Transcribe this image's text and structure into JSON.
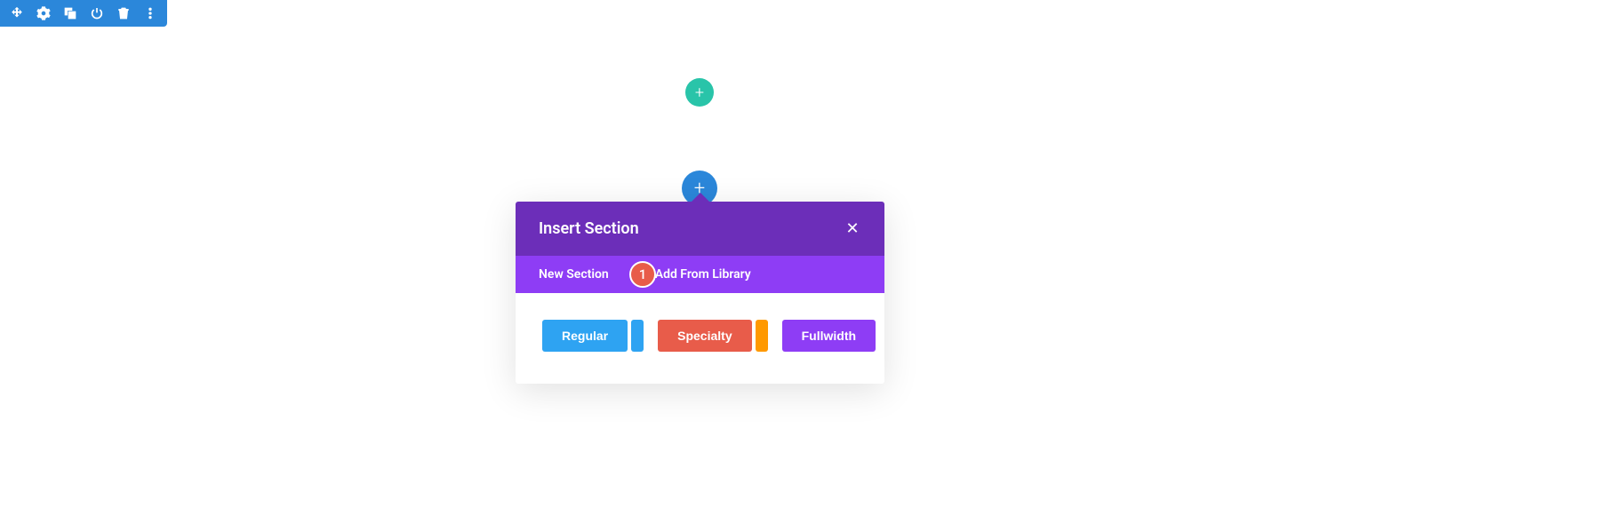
{
  "toolbar": {
    "icons": [
      "move",
      "gear",
      "duplicate",
      "power",
      "trash",
      "more"
    ]
  },
  "addButtons": {
    "green": "+",
    "blue": "+"
  },
  "modal": {
    "title": "Insert Section",
    "close": "✕",
    "tabs": {
      "new": "New Section",
      "library": "Add From Library"
    },
    "annotation": "1",
    "types": {
      "regular": "Regular",
      "specialty": "Specialty",
      "fullwidth": "Fullwidth"
    }
  }
}
